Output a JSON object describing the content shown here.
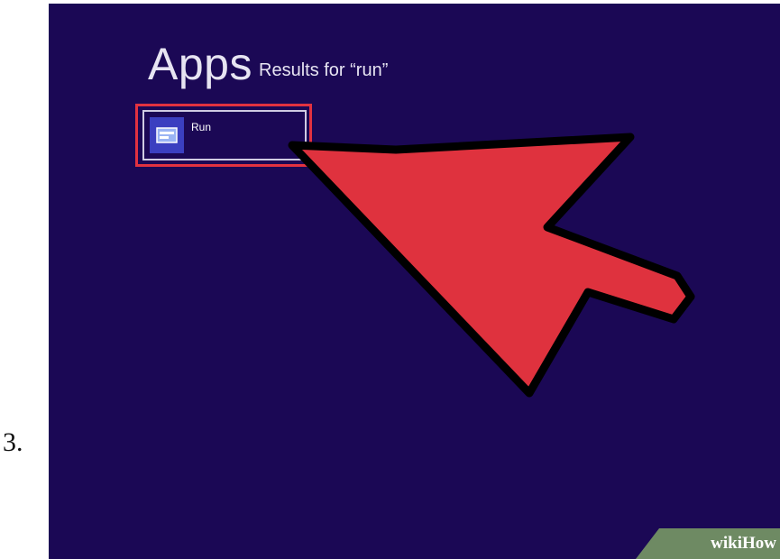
{
  "step": {
    "number": "3."
  },
  "screen": {
    "title": "Apps",
    "results_label": "Results for “run”",
    "results": [
      {
        "label": "Run",
        "icon": "run-app-icon"
      }
    ]
  },
  "overlay": {
    "arrow": "pointer-arrow",
    "highlight_color": "#e23240",
    "arrow_color": "#e0323f"
  },
  "watermark": {
    "text": "wikiHow"
  },
  "colors": {
    "background": "#1b0855",
    "tile_icon": "#3b3fc0"
  }
}
